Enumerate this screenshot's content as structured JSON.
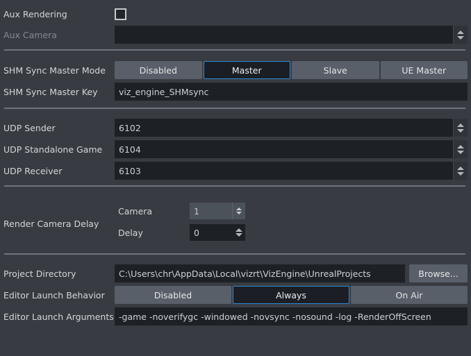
{
  "rows": {
    "aux_rendering": {
      "label": "Aux Rendering",
      "checked": false
    },
    "aux_camera": {
      "label": "Aux Camera",
      "value": "",
      "disabled": true
    },
    "shm_sync_master_mode": {
      "label": "SHM Sync Master Mode",
      "options": [
        "Disabled",
        "Master",
        "Slave",
        "UE Master"
      ],
      "selected": "Master"
    },
    "shm_sync_master_key": {
      "label": "SHM Sync Master Key",
      "value": "viz_engine_SHMsync"
    },
    "udp_sender": {
      "label": "UDP Sender",
      "value": "6102"
    },
    "udp_standalone_game": {
      "label": "UDP Standalone Game",
      "value": "6104"
    },
    "udp_receiver": {
      "label": "UDP Receiver",
      "value": "6103"
    },
    "render_camera_delay": {
      "label": "Render Camera Delay",
      "camera": {
        "label": "Camera",
        "value": "1",
        "disabled": true
      },
      "delay": {
        "label": "Delay",
        "value": "0",
        "disabled": false
      }
    },
    "project_directory": {
      "label": "Project Directory",
      "value": "C:\\Users\\chr\\AppData\\Local\\vizrt\\VizEngine\\UnrealProjects",
      "browse_label": "Browse..."
    },
    "editor_launch_behavior": {
      "label": "Editor Launch Behavior",
      "options": [
        "Disabled",
        "Always",
        "On Air"
      ],
      "selected": "Always"
    },
    "editor_launch_arguments": {
      "label": "Editor Launch Arguments",
      "value": "-game -noverifygc -windowed -novsync -nosound -log -RenderOffScreen"
    }
  },
  "colors": {
    "background": "#383c42",
    "field_background": "#1d2126",
    "segment_background": "#585f68",
    "accent_blue": "#2e8ad8",
    "label_text": "#d4d6d8",
    "label_text_disabled": "#85898f",
    "divider": "#6d747c"
  }
}
